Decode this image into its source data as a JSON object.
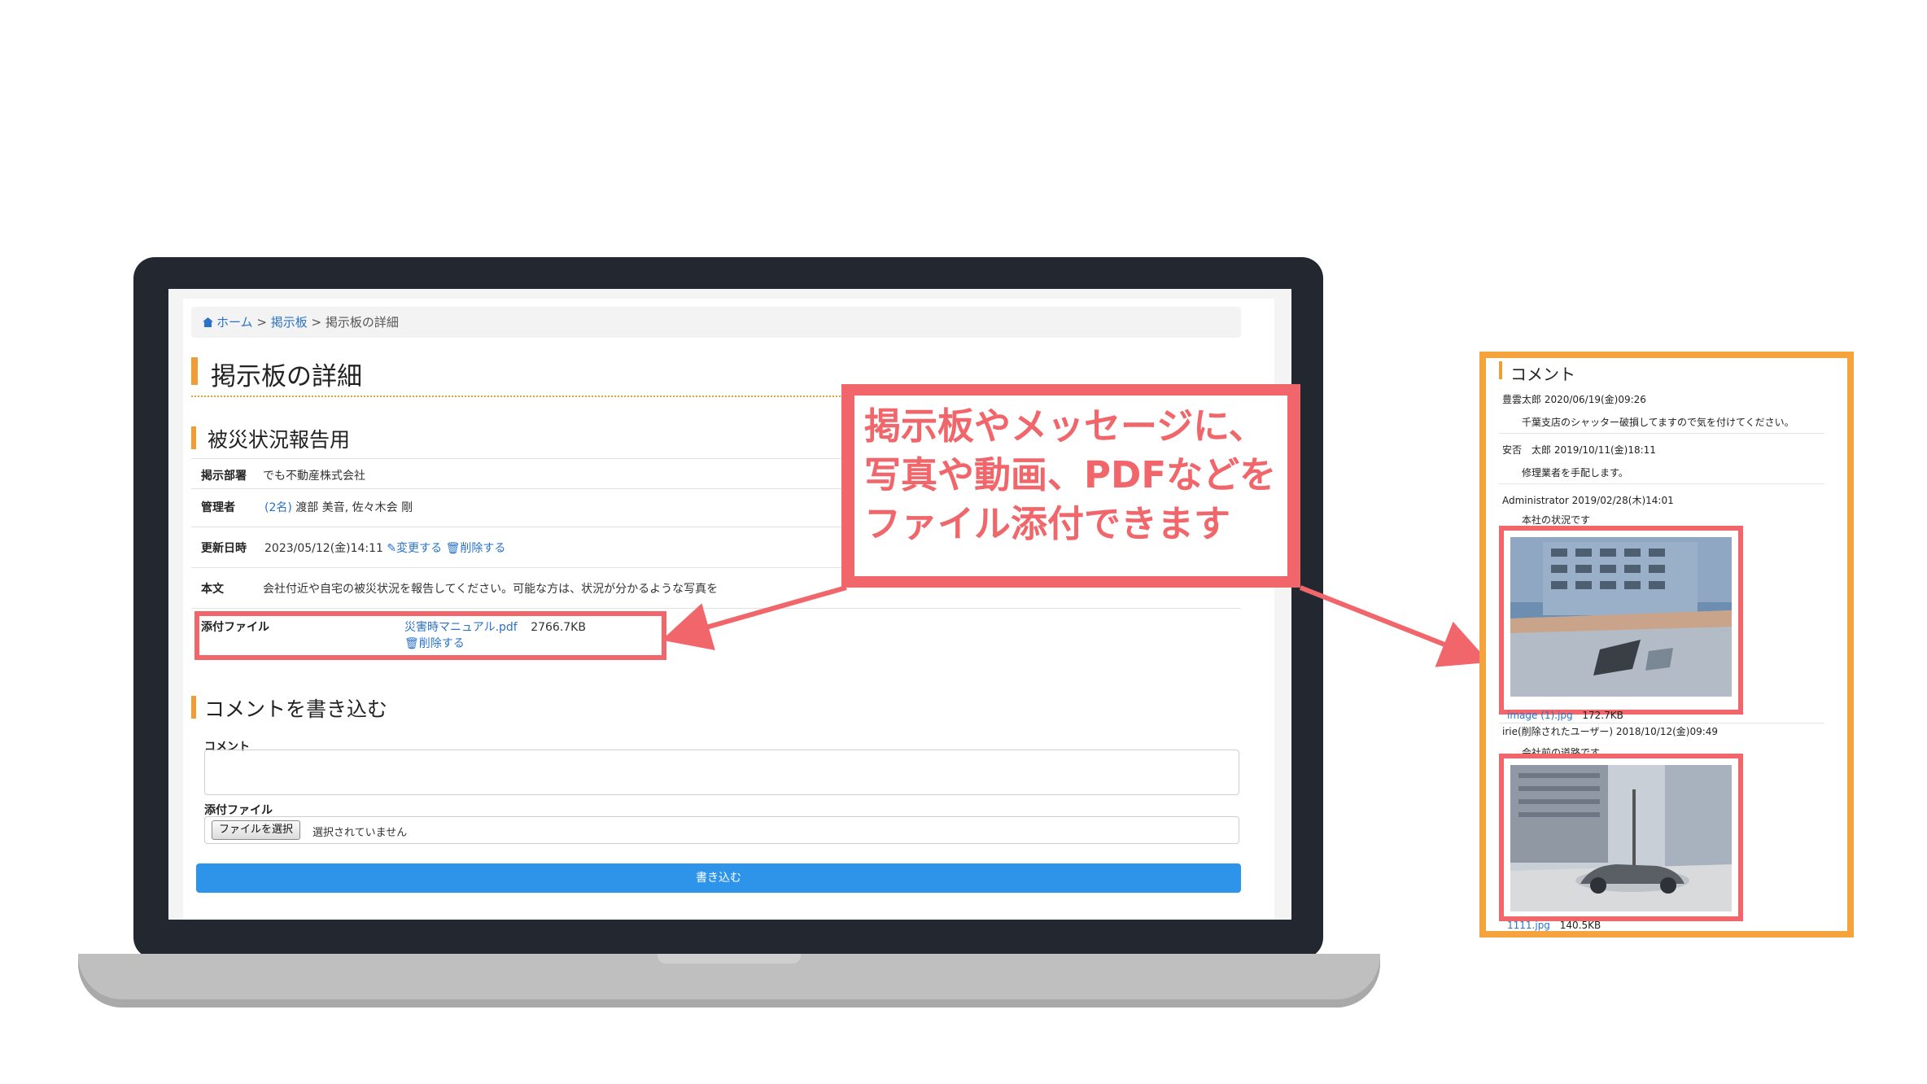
{
  "breadcrumb": {
    "home": "ホーム",
    "sep1": ">",
    "board": "掲示板",
    "sep2": ">",
    "current": "掲示板の詳細"
  },
  "page_title": "掲示板の詳細",
  "post": {
    "heading": "被災状況報告用",
    "rows": {
      "dept_label": "掲示部署",
      "dept_value": "でも不動産株式会社",
      "manager_label": "管理者",
      "manager_count": "(2名)",
      "manager_names": "渡部 美音, 佐々木会 剛",
      "updated_label": "更新日時",
      "updated_value": "2023/05/12(金)14:11",
      "edit_link": "変更する",
      "delete_link": "削除する",
      "body_label": "本文",
      "body_value": "会社付近や自宅の被災状況を報告してください。可能な方は、状況が分かるような写真を",
      "attach_label": "添付ファイル",
      "attach_file": "災害時マニュアル.pdf",
      "attach_size": "2766.7KB",
      "attach_delete": "削除する"
    }
  },
  "comment_form": {
    "heading": "コメントを書き込む",
    "comment_label": "コメント",
    "file_label": "添付ファイル",
    "file_button": "ファイルを選択",
    "file_none": "選択されていません",
    "submit": "書き込む"
  },
  "callout": {
    "line1": "掲示板やメッセージに、",
    "line2": "写真や動画、PDFなどを",
    "line3": "ファイル添付できます"
  },
  "comments_panel": {
    "title": "コメント",
    "c1_meta": "豊雲太郎 2020/06/19(金)09:26",
    "c1_text": "千葉支店のシャッター破損してますので気を付けてください。",
    "c2_meta": "安否　太郎 2019/10/11(金)18:11",
    "c2_text": "修理業者を手配します。",
    "c3_meta": "Administrator 2019/02/28(木)14:01",
    "c3_text": "本社の状況です",
    "c3_file": "image (1).jpg",
    "c3_size": "172.7KB",
    "c4_meta": "irie(削除されたユーザー) 2018/10/12(金)09:49",
    "c4_text": "会社前の道路です",
    "c4_file": "1111.jpg",
    "c4_size": "140.5KB"
  },
  "colors": {
    "accent_orange": "#f39c35",
    "callout_red": "#f0666a",
    "link_blue": "#2a72c8",
    "button_blue": "#2e94ea",
    "panel_border": "#f5a33c"
  }
}
